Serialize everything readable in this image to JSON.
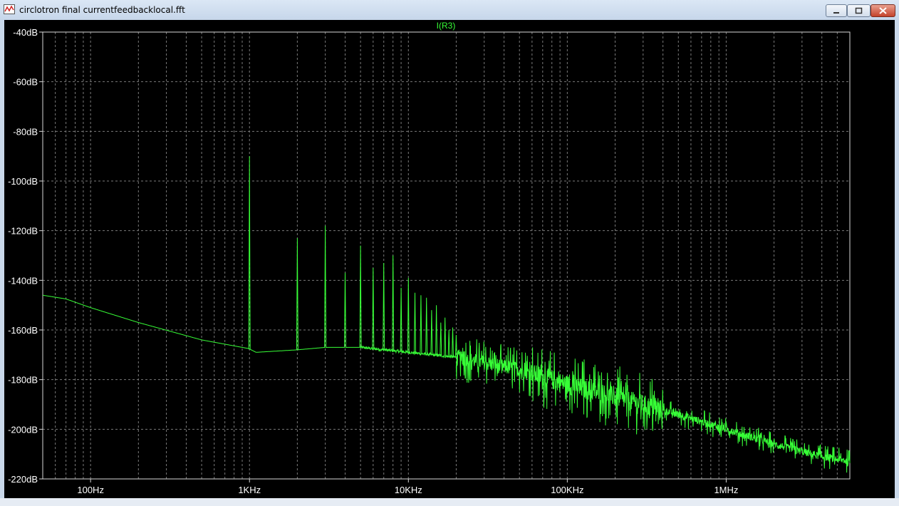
{
  "window": {
    "title": "circlotron final currentfeedbacklocal.fft",
    "icon": "waveform-viewer-icon",
    "controls": {
      "minimize": "minimize-icon",
      "maximize": "maximize-icon",
      "close": "close-icon"
    }
  },
  "colors": {
    "trace": "#37ff37",
    "background": "#000000",
    "grid": "#7a7a7a",
    "axis_text": "#ffffff",
    "frame": "#d8d8d8"
  },
  "chart_data": {
    "type": "line",
    "title": "I(R3)",
    "x_scale": "log",
    "xlim": [
      50,
      6000000
    ],
    "ylim": [
      -220,
      -40
    ],
    "x_ticks": [
      {
        "value": 100,
        "label": "100Hz"
      },
      {
        "value": 1000,
        "label": "1KHz"
      },
      {
        "value": 10000,
        "label": "10KHz"
      },
      {
        "value": 100000,
        "label": "100KHz"
      },
      {
        "value": 1000000,
        "label": "1MHz"
      }
    ],
    "y_ticks": [
      {
        "value": -40,
        "label": "-40dB"
      },
      {
        "value": -60,
        "label": "-60dB"
      },
      {
        "value": -80,
        "label": "-80dB"
      },
      {
        "value": -100,
        "label": "-100dB"
      },
      {
        "value": -120,
        "label": "-120dB"
      },
      {
        "value": -140,
        "label": "-140dB"
      },
      {
        "value": -160,
        "label": "-160dB"
      },
      {
        "value": -180,
        "label": "-180dB"
      },
      {
        "value": -200,
        "label": "-200dB"
      },
      {
        "value": -220,
        "label": "-220dB"
      }
    ],
    "grid": true,
    "series": [
      {
        "name": "I(R3)",
        "noise_floor": {
          "x": [
            50,
            70,
            100,
            200,
            500,
            990,
            1100,
            2000,
            3000,
            5000,
            10000,
            20000,
            50000,
            100000,
            200000,
            500000,
            1000000,
            2000000,
            4000000,
            6000000
          ],
          "y": [
            -146,
            -147.5,
            -151,
            -157,
            -164,
            -167.5,
            -169,
            -168,
            -167,
            -167,
            -169,
            -171,
            -176,
            -182,
            -187,
            -194,
            -200,
            -206,
            -211,
            -213
          ]
        },
        "harmonics": {
          "x": [
            1000,
            2000,
            3000,
            4000,
            5000,
            6000,
            7000,
            8000,
            9000,
            10000,
            11000,
            12000,
            13000,
            14000,
            15000,
            16000,
            17000,
            18000,
            19000,
            20000
          ],
          "y": [
            -90,
            -123,
            -118,
            -137,
            -126,
            -135,
            -133,
            -130,
            -143,
            -139,
            -145,
            -146,
            -147,
            -152,
            -150,
            -157,
            -155,
            -160,
            -159,
            -162
          ]
        }
      }
    ]
  }
}
